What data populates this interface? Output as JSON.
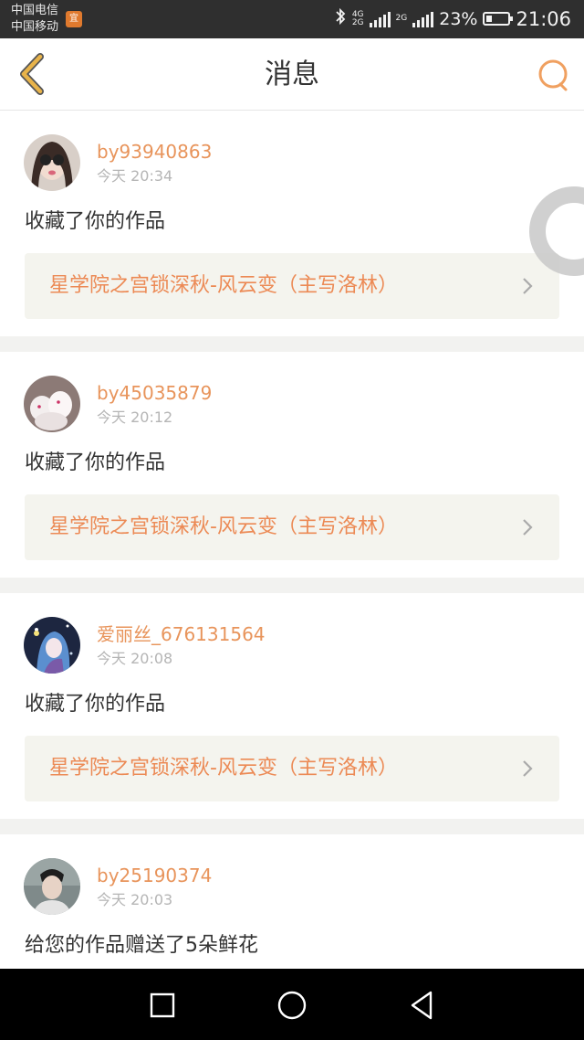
{
  "status_bar": {
    "carrier_1": "中国电信",
    "carrier_2": "中国移动",
    "sim_badge": "宜",
    "net_4g_a": "4G",
    "net_4g_b": "2G",
    "net_2g": "2G",
    "battery_percent": "23%",
    "battery_level": 0.23,
    "time": "21:06"
  },
  "header": {
    "title": "消息",
    "back_icon": "chevron-left-icon",
    "search_icon": "search-icon",
    "accent_color": "#e8b34a",
    "search_color": "#f0a060"
  },
  "messages": [
    {
      "username": "by93940863",
      "time": "今天 20:34",
      "action": "收藏了你的作品",
      "work_title": "星学院之宫锁深秋-风云变（主写洛林）"
    },
    {
      "username": "by45035879",
      "time": "今天 20:12",
      "action": "收藏了你的作品",
      "work_title": "星学院之宫锁深秋-风云变（主写洛林）"
    },
    {
      "username": "爱丽丝_676131564",
      "time": "今天 20:08",
      "action": "收藏了你的作品",
      "work_title": "星学院之宫锁深秋-风云变（主写洛林）"
    },
    {
      "username": "by25190374",
      "time": "今天 20:03",
      "action": "给您的作品赠送了5朵鲜花",
      "work_title": ""
    }
  ],
  "colors": {
    "username": "#e8945b",
    "work_title": "#ec8a55",
    "time": "#b5b5b5",
    "card_link_bg": "#f4f4ee"
  }
}
